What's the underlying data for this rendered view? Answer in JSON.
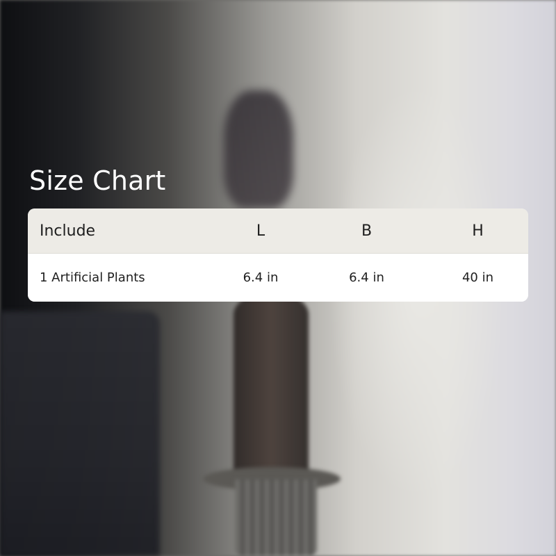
{
  "title": "Size Chart",
  "table": {
    "headers": [
      "Include",
      "L",
      "B",
      "H"
    ],
    "rows": [
      [
        "1 Artificial Plants",
        "6.4 in",
        "6.4 in",
        "40 in"
      ]
    ]
  }
}
